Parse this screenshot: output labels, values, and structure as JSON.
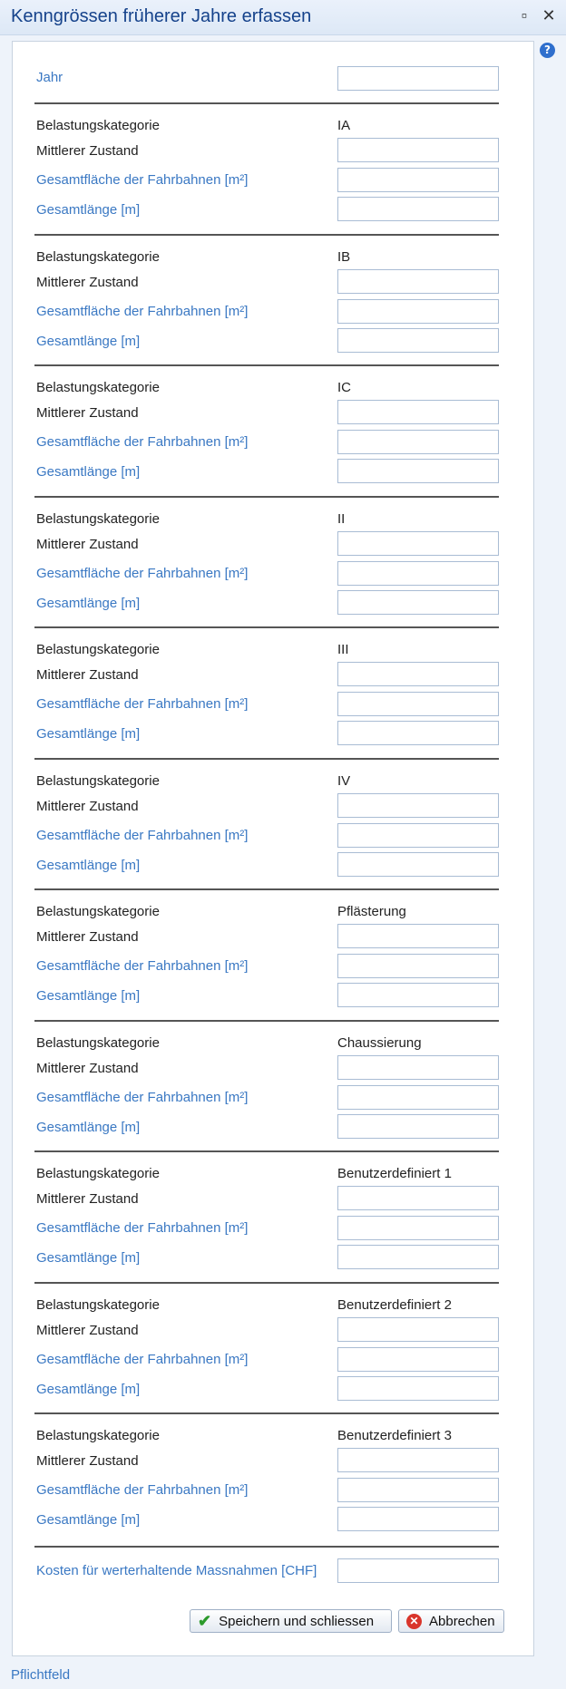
{
  "window": {
    "title": "Kenngrössen früherer Jahre erfassen",
    "maximize_icon": "▫",
    "close_icon": "✕",
    "help_icon": "?"
  },
  "form": {
    "jahr_label": "Jahr",
    "kosten_label": "Kosten für werterhaltende Massnahmen [CHF]",
    "sections": [
      {
        "label": "Belastungskategorie",
        "value": "IA",
        "zustand": "Mittlerer Zustand",
        "flaeche": "Gesamtfläche der Fahrbahnen [m²]",
        "laenge": "Gesamtlänge [m]"
      },
      {
        "label": "Belastungskategorie",
        "value": "IB",
        "zustand": "Mittlerer Zustand",
        "flaeche": "Gesamtfläche der Fahrbahnen [m²]",
        "laenge": "Gesamtlänge [m]"
      },
      {
        "label": "Belastungskategorie",
        "value": "IC",
        "zustand": "Mittlerer Zustand",
        "flaeche": "Gesamtfläche der Fahrbahnen [m²]",
        "laenge": "Gesamtlänge [m]"
      },
      {
        "label": "Belastungskategorie",
        "value": "II",
        "zustand": "Mittlerer Zustand",
        "flaeche": "Gesamtfläche der Fahrbahnen [m²]",
        "laenge": "Gesamtlänge [m]"
      },
      {
        "label": "Belastungskategorie",
        "value": "III",
        "zustand": "Mittlerer Zustand",
        "flaeche": "Gesamtfläche der Fahrbahnen [m²]",
        "laenge": "Gesamtlänge [m]"
      },
      {
        "label": "Belastungskategorie",
        "value": "IV",
        "zustand": "Mittlerer Zustand",
        "flaeche": "Gesamtfläche der Fahrbahnen [m²]",
        "laenge": "Gesamtlänge [m]"
      },
      {
        "label": "Belastungskategorie",
        "value": "Pflästerung",
        "zustand": "Mittlerer Zustand",
        "flaeche": "Gesamtfläche der Fahrbahnen [m²]",
        "laenge": "Gesamtlänge [m]"
      },
      {
        "label": "Belastungskategorie",
        "value": "Chaussierung",
        "zustand": "Mittlerer Zustand",
        "flaeche": "Gesamtfläche der Fahrbahnen [m²]",
        "laenge": "Gesamtlänge [m]"
      },
      {
        "label": "Belastungskategorie",
        "value": "Benutzerdefiniert 1",
        "zustand": "Mittlerer Zustand",
        "flaeche": "Gesamtfläche der Fahrbahnen [m²]",
        "laenge": "Gesamtlänge [m]"
      },
      {
        "label": "Belastungskategorie",
        "value": "Benutzerdefiniert 2",
        "zustand": "Mittlerer Zustand",
        "flaeche": "Gesamtfläche der Fahrbahnen [m²]",
        "laenge": "Gesamtlänge [m]"
      },
      {
        "label": "Belastungskategorie",
        "value": "Benutzerdefiniert 3",
        "zustand": "Mittlerer Zustand",
        "flaeche": "Gesamtfläche der Fahrbahnen [m²]",
        "laenge": "Gesamtlänge [m]"
      }
    ]
  },
  "buttons": {
    "save_label": "Speichern und schliessen",
    "cancel_label": "Abbrechen"
  },
  "footer": {
    "required_note": "Pflichtfeld"
  },
  "colors": {
    "required_label": "#3a78c3",
    "title_text": "#15428b"
  }
}
